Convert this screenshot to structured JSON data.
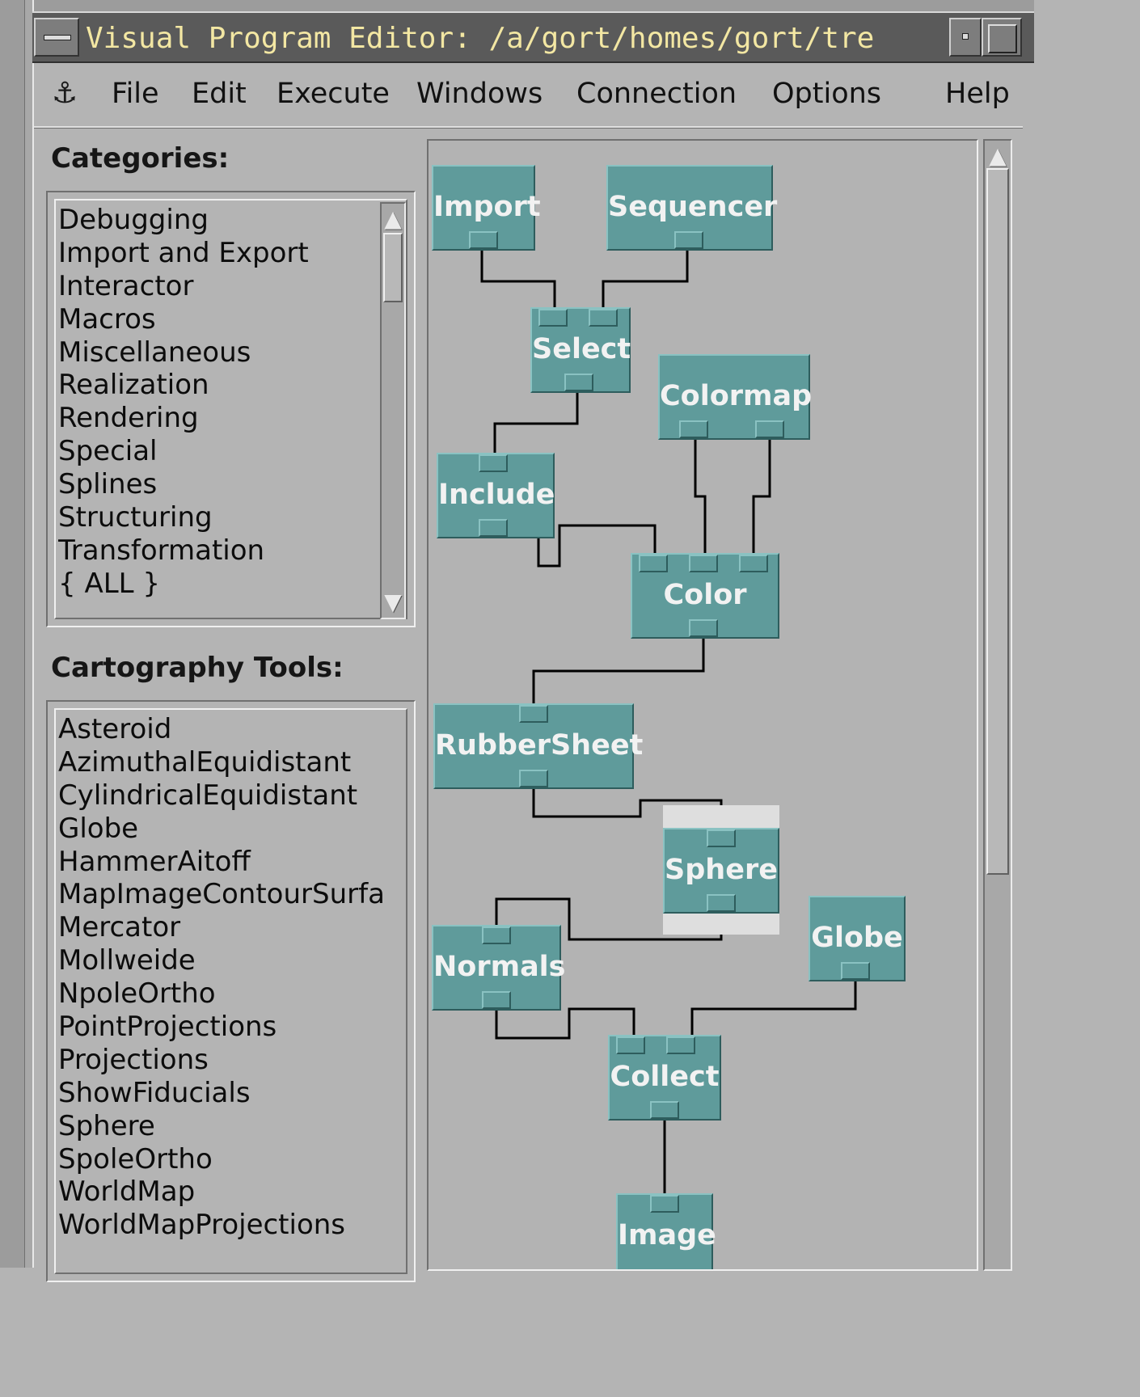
{
  "window": {
    "title": "Visual Program Editor: /a/gort/homes/gort/tre"
  },
  "menubar": {
    "items": [
      "File",
      "Edit",
      "Execute",
      "Windows",
      "Connection",
      "Options",
      "Help"
    ],
    "anchor_icon": "anchor-icon"
  },
  "categories": {
    "label": "Categories:",
    "items": [
      "Debugging",
      "Import and Export",
      "Interactor",
      "Macros",
      "Miscellaneous",
      "Realization",
      "Rendering",
      "Special",
      "Splines",
      "Structuring",
      "Transformation",
      "{ ALL }"
    ]
  },
  "tools": {
    "label": "Cartography Tools:",
    "items": [
      "Asteroid",
      "AzimuthalEquidistant",
      "CylindricalEquidistant",
      "Globe",
      "HammerAitoff",
      "MapImageContourSurfa",
      "Mercator",
      "Mollweide",
      "NpoleOrtho",
      "PointProjections",
      "Projections",
      "ShowFiducials",
      "Sphere",
      "SpoleOrtho",
      "WorldMap",
      "WorldMapProjections"
    ]
  },
  "network": {
    "modules": [
      "Import",
      "Sequencer",
      "Select",
      "Colormap",
      "Include",
      "Color",
      "RubberSheet",
      "Sphere",
      "Normals",
      "Globe",
      "Collect",
      "Image"
    ],
    "colors": {
      "module": "#5f9b9b",
      "wire": "#000000",
      "canvas": "#b3b3b3"
    }
  }
}
